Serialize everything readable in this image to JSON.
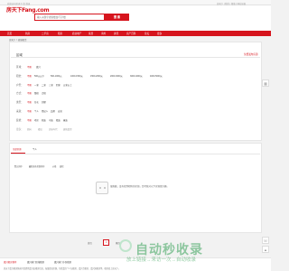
{
  "topbar": {
    "left": "欢迎访问房天下 请 登录",
    "right": "房天下 | 我的 | 帮助 | 网站导航"
  },
  "header": {
    "logo": "房天下Fang.com",
    "search_placeholder": "输入关键字搜索楼盘/写字楼",
    "search_button": "搜 索"
  },
  "nav": {
    "items": [
      "首页",
      "新房",
      "二手房",
      "租房",
      "商业地产",
      "家居",
      "海外",
      "资讯",
      "房产百科",
      "论坛",
      "更多"
    ]
  },
  "breadcrumb": "房天下 > 商铺租赁",
  "filter": {
    "title": "区域",
    "subtab": "免费发布房源",
    "rows": [
      {
        "label": "区域：",
        "options": [
          "不限",
          "嘉兴"
        ]
      },
      {
        "label": "租金：",
        "options": [
          "不限",
          "500元以下",
          "500-1000元",
          "1000-1500元",
          "1500-2000元",
          "2000-3000元",
          "3000-4000元",
          "4000-5000元"
        ]
      },
      {
        "label": "户型：",
        "options": [
          "不限",
          "一室",
          "二室",
          "三室",
          "四室",
          "五室以上"
        ]
      },
      {
        "label": "方式：",
        "options": [
          "不限",
          "整租",
          "合租"
        ]
      },
      {
        "label": "类型：",
        "options": [
          "不限",
          "住宅",
          "别墅"
        ]
      },
      {
        "label": "来源：",
        "options": [
          "不限",
          "个人",
          "经纪人",
          "品牌",
          "自营"
        ]
      },
      {
        "label": "装修：",
        "options": [
          "不限",
          "毛坯",
          "简装",
          "中装",
          "精装",
          "豪装"
        ]
      },
      {
        "label": "更多：",
        "options": [
          "朝向",
          "楼层",
          "房屋年代",
          "建筑类型"
        ]
      }
    ]
  },
  "list": {
    "tabs": [
      "全部房源",
      "个人"
    ],
    "sort": [
      "默认排序",
      "最新发布房源排序",
      "价格",
      "面积"
    ],
    "empty_text": "很抱歉，没有找到相符的房源，您可能对以下房源感兴趣。"
  },
  "pager": {
    "prev": "首页",
    "current": "1",
    "next": "尾页"
  },
  "watermark": {
    "big": "自动秒收录",
    "small": "放上链接→来访一次→自动收录"
  },
  "bottom": {
    "tabs": [
      "嘉兴租房推荐",
      "嘉兴热门区域租房",
      "嘉兴热门小区租房"
    ],
    "note": "房天下嘉兴租房频道为您提供嘉兴出租房信息，海量真实房源，包括嘉兴个人出租房、嘉兴合租房、嘉兴短租房等，租房就上房天下。"
  },
  "side_icons": [
    "qr-icon",
    "headset-icon",
    "arrow-up-icon"
  ],
  "colors": {
    "brand": "#d6141d",
    "watermark": "#3aa35a"
  }
}
